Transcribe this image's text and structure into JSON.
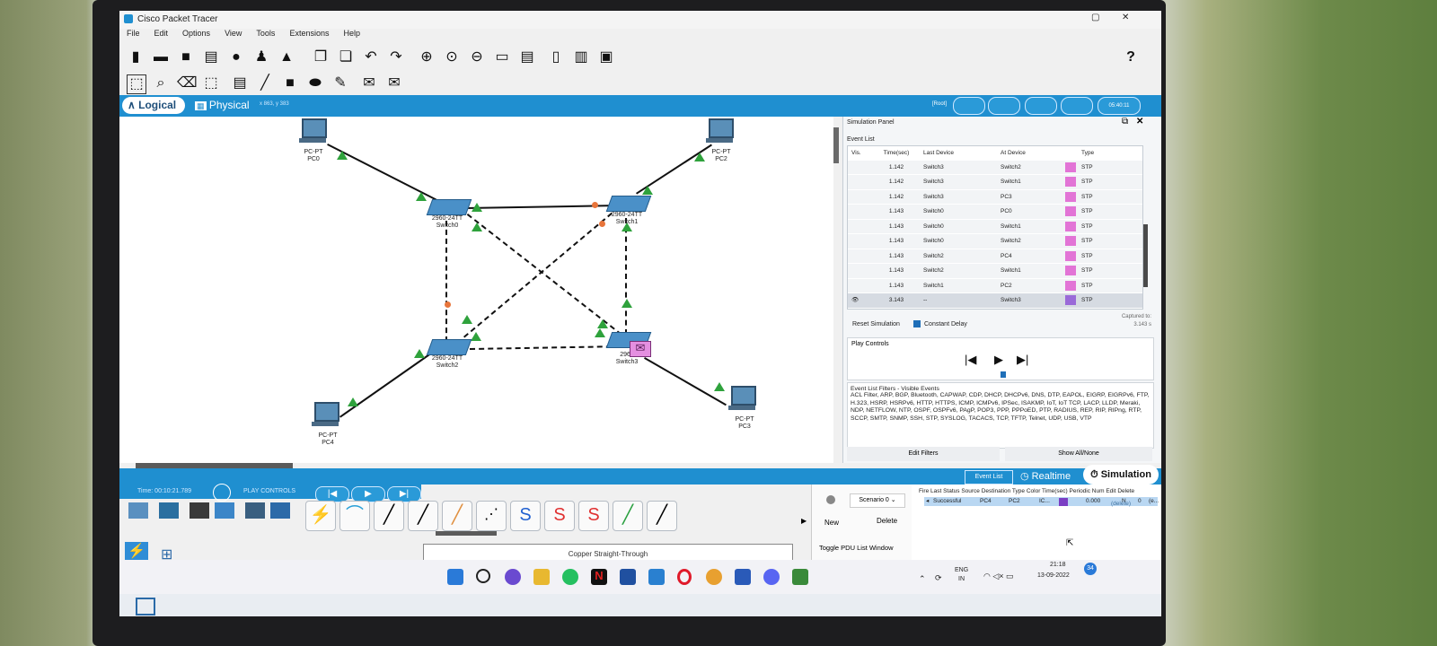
{
  "app": {
    "title": "Cisco Packet Tracer"
  },
  "menu": [
    "File",
    "Edit",
    "Options",
    "View",
    "Tools",
    "Extensions",
    "Help"
  ],
  "help_label": "?",
  "workspace": {
    "logical": "Logical",
    "physical": "Physical",
    "coords": "x 863, y 383",
    "root": "[Root]",
    "clock": "05:40:11"
  },
  "devices": {
    "pc0": {
      "type": "PC-PT",
      "name": "PC0"
    },
    "pc2": {
      "type": "PC-PT",
      "name": "PC2"
    },
    "pc4": {
      "type": "PC-PT",
      "name": "PC4"
    },
    "pc3": {
      "type": "PC-PT",
      "name": "PC3"
    },
    "sw0": {
      "type": "2960-24TT",
      "name": "Switch0"
    },
    "sw1": {
      "type": "2960-24TT",
      "name": "Switch1"
    },
    "sw2": {
      "type": "2960-24TT",
      "name": "Switch2"
    },
    "sw3": {
      "type": "2960",
      "name": "Switch3"
    }
  },
  "sim": {
    "title": "Simulation Panel",
    "event_list": "Event List",
    "cols": {
      "vis": "Vis.",
      "time": "Time(sec)",
      "last": "Last Device",
      "at": "At Device",
      "type": "Type"
    },
    "rows": [
      {
        "time": "1.142",
        "last": "Switch3",
        "at": "Switch2",
        "type": "STP"
      },
      {
        "time": "1.142",
        "last": "Switch3",
        "at": "Switch1",
        "type": "STP"
      },
      {
        "time": "1.142",
        "last": "Switch3",
        "at": "PC3",
        "type": "STP"
      },
      {
        "time": "1.143",
        "last": "Switch0",
        "at": "PC0",
        "type": "STP"
      },
      {
        "time": "1.143",
        "last": "Switch0",
        "at": "Switch1",
        "type": "STP"
      },
      {
        "time": "1.143",
        "last": "Switch0",
        "at": "Switch2",
        "type": "STP"
      },
      {
        "time": "1.143",
        "last": "Switch2",
        "at": "PC4",
        "type": "STP"
      },
      {
        "time": "1.143",
        "last": "Switch2",
        "at": "Switch1",
        "type": "STP"
      },
      {
        "time": "1.143",
        "last": "Switch1",
        "at": "PC2",
        "type": "STP"
      },
      {
        "time": "3.143",
        "last": "--",
        "at": "Switch3",
        "type": "STP"
      }
    ],
    "reset": "Reset Simulation",
    "constant_delay": "Constant Delay",
    "captured_label": "Captured to:",
    "captured_value": "3.143 s",
    "play_controls": "Play Controls",
    "filters_title": "Event List Filters - Visible Events",
    "filters_text": "ACL Filter, ARP, BGP, Bluetooth, CAPWAP, CDP, DHCP, DHCPv6, DNS, DTP, EAPOL, EIGRP, EIGRPv6, FTP, H.323, HSRP, HSRPv6, HTTP, HTTPS, ICMP, ICMPv6, IPSec, ISAKMP, IoT, IoT TCP, LACP, LLDP, Meraki, NDP, NETFLOW, NTP, OSPF, OSPFv6, PAgP, POP3, PPP, PPPoED, PTP, RADIUS, REP, RIP, RIPng, RTP, SCCP, SMTP, SNMP, SSH, STP, SYSLOG, TACACS, TCP, TFTP, Telnet, UDP, USB, VTP",
    "edit_filters": "Edit Filters",
    "show_all": "Show All/None"
  },
  "modes": {
    "event_list": "Event List",
    "realtime": "Realtime",
    "simulation": "Simulation"
  },
  "timeline": {
    "time": "Time: 00:10:21.789",
    "play_controls": "PLAY CONTROLS"
  },
  "cable_name": "Copper Straight-Through",
  "pdu": {
    "scenario": "Scenario 0",
    "new": "New",
    "delete": "Delete",
    "toggle": "Toggle PDU List Window",
    "headers": "Fire  Last Status  Source  Destination  Type  Color  Time(sec)  Periodic  Num  Edit  Delete",
    "row": {
      "status": "Successful",
      "source": "PC4",
      "dest": "PC2",
      "type": "IC...",
      "time": "0.000",
      "periodic": "N",
      "num": "0",
      "edit": "(e...",
      "delete": "(delete)"
    },
    "row_color": "#7b3fc4"
  },
  "taskbar": {
    "lang1": "ENG",
    "lang2": "IN",
    "time": "21:18",
    "date": "13-09-2022",
    "badge": "34"
  },
  "colors": {
    "accent": "#1f8fd0",
    "stp": "#e274d6",
    "link_up": "#2fa23c",
    "link_blocked": "#e8753b"
  }
}
